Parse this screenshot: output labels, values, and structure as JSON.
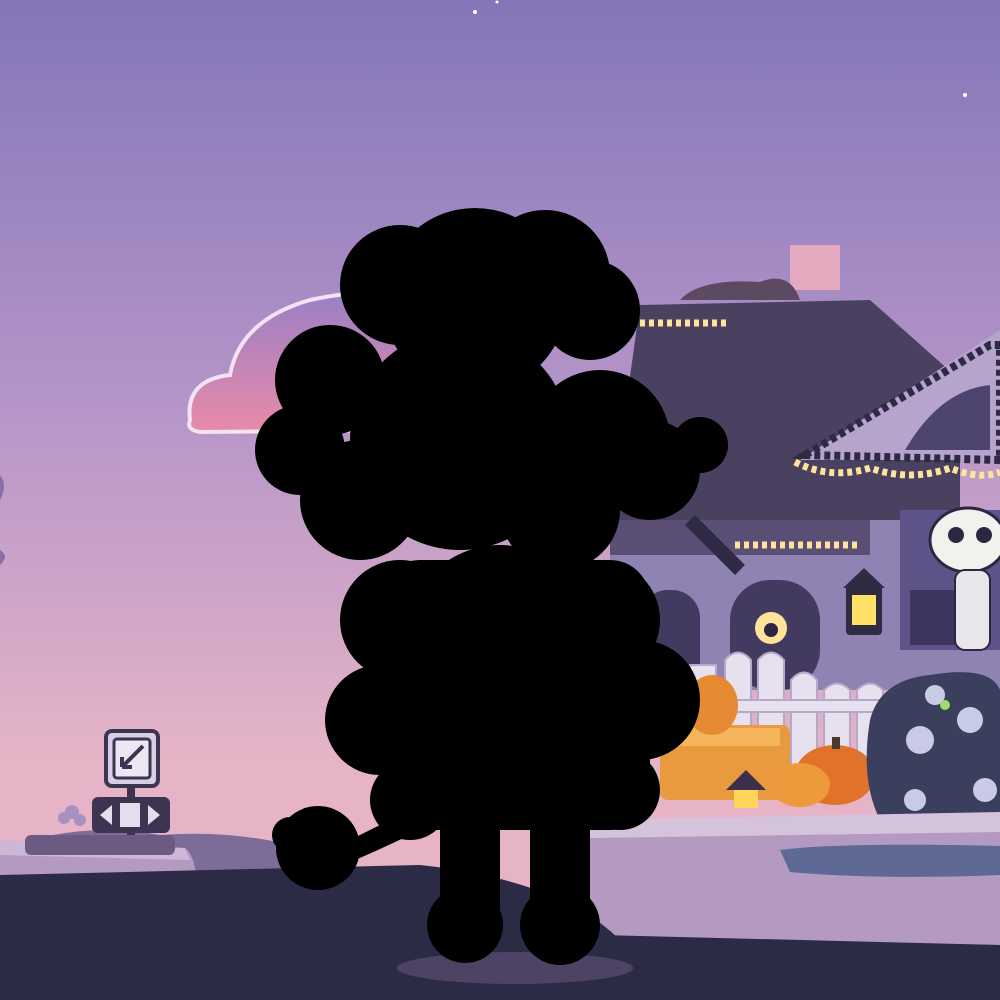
{
  "scene": {
    "description_items": [
      "sky",
      "house",
      "sign",
      "pumpkins",
      "skeleton",
      "bush",
      "fence",
      "lamp",
      "silhouette"
    ]
  },
  "palette": {
    "sky_top": "#8476b8",
    "sky_mid": "#b595c9",
    "sky_horizon": "#e6b4c6",
    "road": "#2c2b45",
    "sidewalk": "#b49ac0",
    "house_wall": "#8f83b3",
    "roof": "#4a4060",
    "silhouette": "#000000",
    "pumpkin": "#e58a32",
    "light_bulb": "#ffe39a",
    "bush": "#3b3f5e"
  }
}
